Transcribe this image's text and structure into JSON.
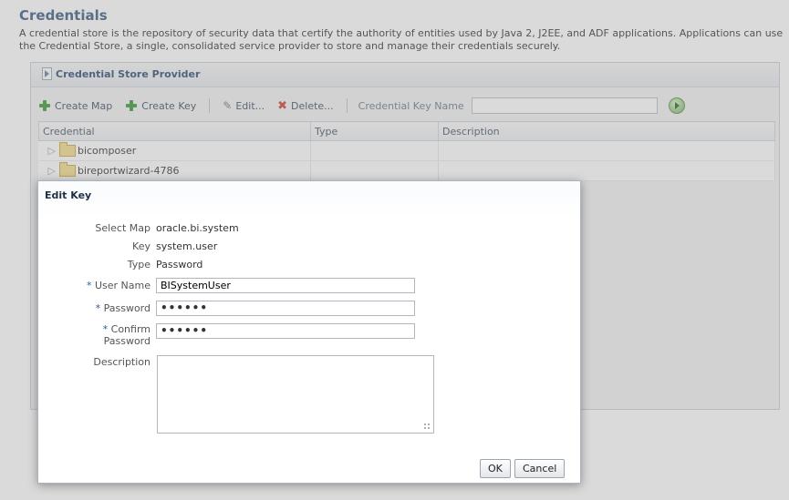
{
  "page": {
    "title": "Credentials",
    "description": "A credential store is the repository of security data that certify the authority of entities used by Java 2, J2EE, and ADF applications. Applications can use the Credential Store, a single, consolidated service provider to store and manage their credentials securely."
  },
  "panel": {
    "header": "Credential Store Provider"
  },
  "toolbar": {
    "create_map": "Create Map",
    "create_key": "Create Key",
    "edit": "Edit...",
    "delete": "Delete...",
    "search_label": "Credential Key Name",
    "search_value": ""
  },
  "grid": {
    "columns": [
      "Credential",
      "Type",
      "Description"
    ],
    "rows": [
      {
        "credential": "bicomposer",
        "type": "",
        "description": ""
      },
      {
        "credential": "bireportwizard-4786",
        "type": "",
        "description": ""
      }
    ]
  },
  "modal": {
    "title": "Edit Key",
    "select_map_label": "Select Map",
    "select_map_value": "oracle.bi.system",
    "key_label": "Key",
    "key_value": "system.user",
    "type_label": "Type",
    "type_value": "Password",
    "user_name_label": "User Name",
    "user_name_value": "BISystemUser",
    "password_label": "Password",
    "password_value": "••••••",
    "confirm_label_1": "Confirm",
    "confirm_label_2": "Password",
    "confirm_value": "••••••",
    "description_label": "Description",
    "description_value": "",
    "ok": "OK",
    "cancel": "Cancel"
  },
  "colors": {
    "title": "#3a5a80",
    "accent": "#2b4b74",
    "add": "#3a9a32",
    "delete": "#d0402a"
  }
}
